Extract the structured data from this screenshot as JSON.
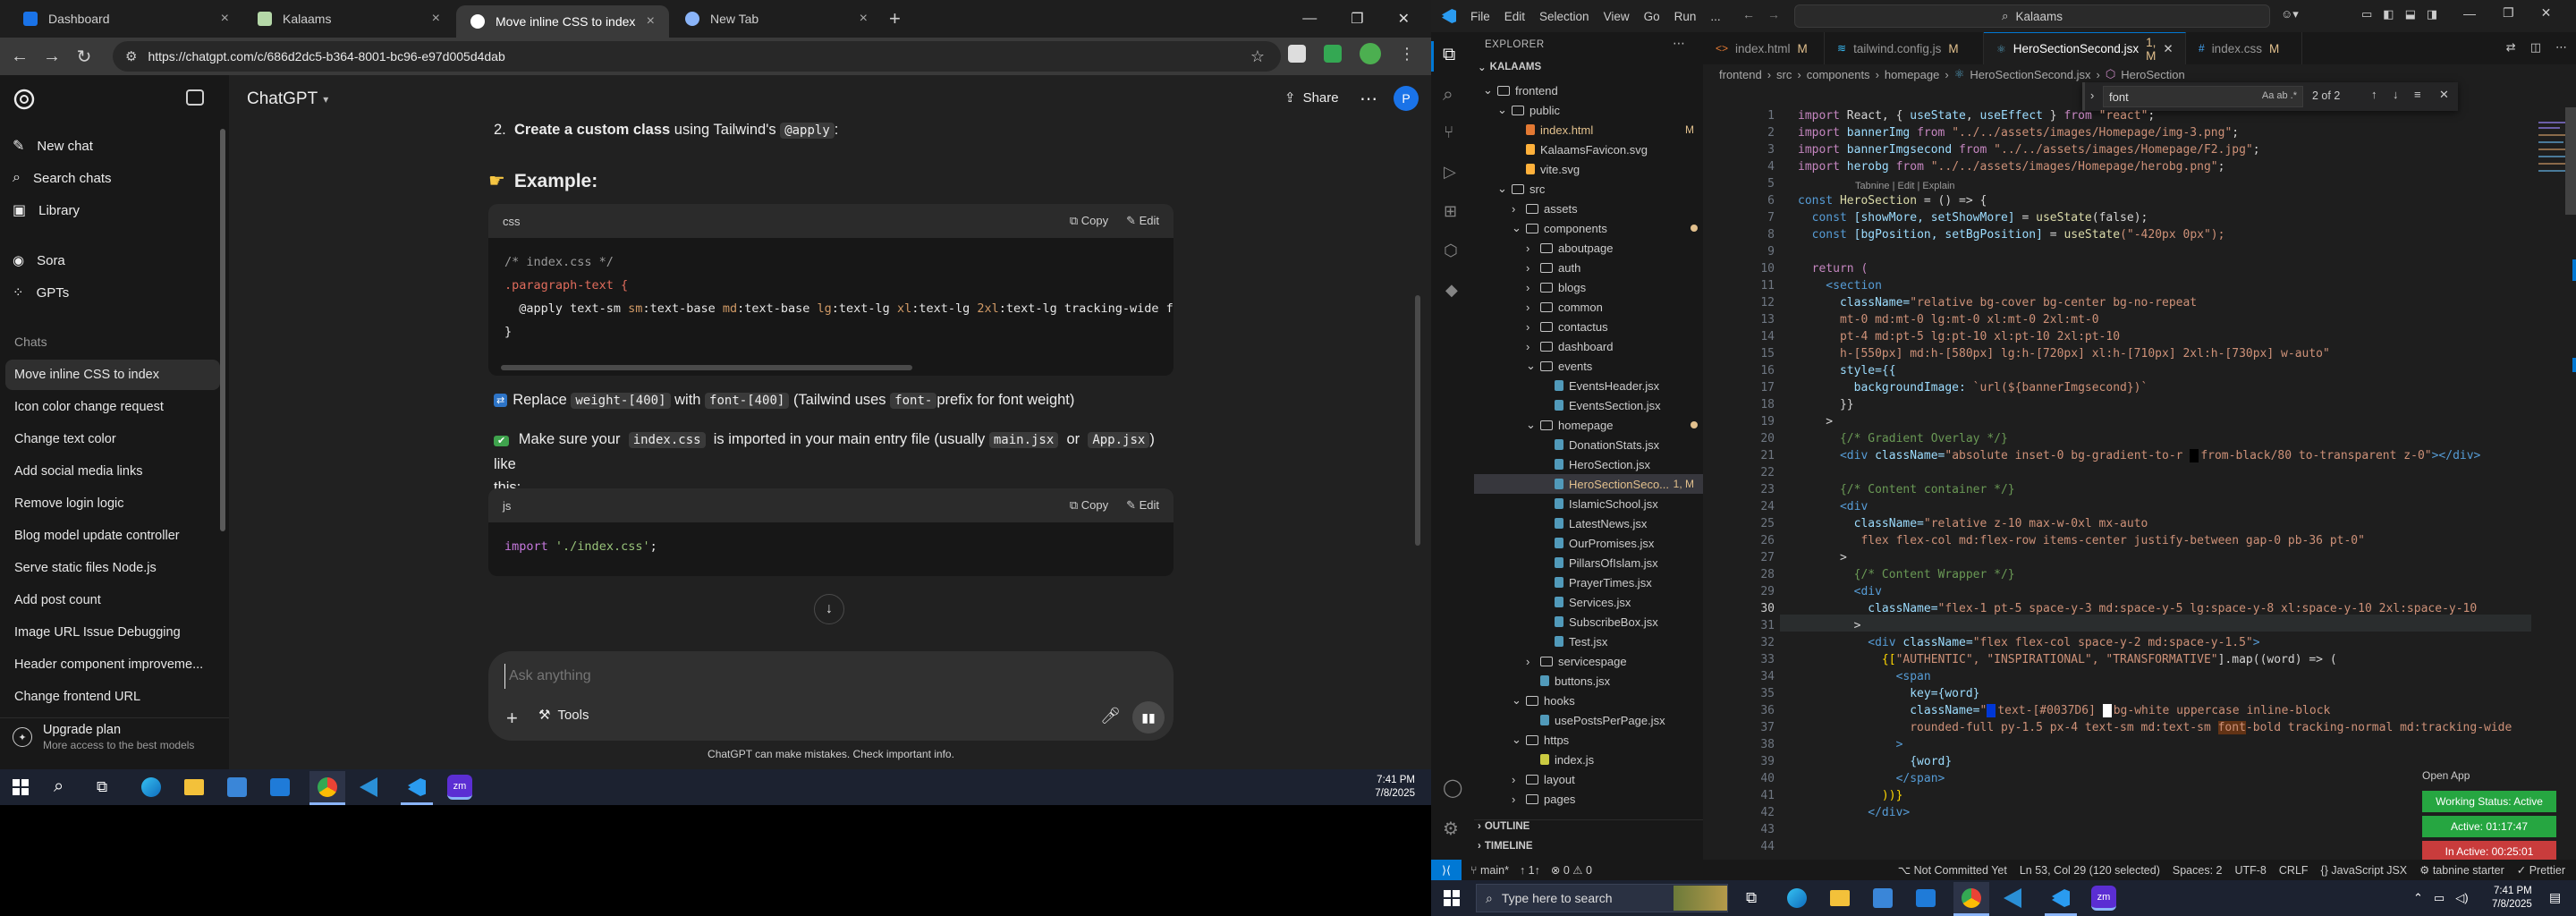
{
  "browser": {
    "tabs": [
      {
        "label": "Dashboard",
        "active": false
      },
      {
        "label": "Kalaams",
        "active": false
      },
      {
        "label": "Move inline CSS to index",
        "active": true
      },
      {
        "label": "New Tab",
        "active": false
      }
    ],
    "url": "https://chatgpt.com/c/686d2dc5-b364-8001-bc96-e97d005d4dab"
  },
  "chatgpt": {
    "model": "ChatGPT",
    "share_label": "Share",
    "sidebar": {
      "top_items": [
        "New chat",
        "Search chats",
        "Library"
      ],
      "gpt_items": [
        "Sora",
        "GPTs"
      ],
      "chats_heading": "Chats",
      "chats": [
        "Move inline CSS to index",
        "Icon color change request",
        "Change text color",
        "Add social media links",
        "Remove login logic",
        "Blog model update controller",
        "Serve static files Node.js",
        "Add post count",
        "Image URL Issue Debugging",
        "Header component improveme...",
        "Change frontend URL"
      ],
      "upgrade_title": "Upgrade plan",
      "upgrade_sub": "More access to the best models"
    },
    "message": {
      "step_num": "2.",
      "step_bold": "Create a custom class",
      "step_rest": " using Tailwind's ",
      "step_code": "@apply",
      "step_end": ":",
      "example_heading": "Example:",
      "code1": {
        "lang": "css",
        "copy": "Copy",
        "edit": "Edit",
        "line1": "/* index.css */",
        "line2": ".paragraph-text {",
        "line3_a": "  @apply text-sm ",
        "line3_b": "sm",
        "line3_c": ":text-base ",
        "line3_d": "md",
        "line3_e": ":text-base ",
        "line3_f": "lg",
        "line3_g": ":text-lg ",
        "line3_h": "xl",
        "line3_i": ":text-lg ",
        "line3_j": "2xl",
        "line3_k": ":text-lg tracking-wide font-[",
        "line4": "}"
      },
      "replace_a": " Replace ",
      "replace_code1": "weight-[400]",
      "replace_b": " with ",
      "replace_code2": "font-[400]",
      "replace_c": " (Tailwind uses ",
      "replace_code3": "font-",
      "replace_d": " prefix for font weight)",
      "sure_a": " Make sure your ",
      "sure_code1": "index.css",
      "sure_b": " is imported in your main entry file (usually ",
      "sure_code2": "main.jsx",
      "sure_c": " or ",
      "sure_code3": "App.jsx",
      "sure_d": ") like",
      "sure_e": "this:",
      "code2": {
        "lang": "js",
        "copy": "Copy",
        "edit": "Edit",
        "kw": "import",
        "str": "'./index.css'",
        "end": ";"
      }
    },
    "composer": {
      "placeholder": "Ask anything",
      "tools": "Tools",
      "disclaimer": "ChatGPT can make mistakes. Check important info."
    }
  },
  "taskbar_left": {
    "time": "7:41 PM",
    "date": "7/8/2025"
  },
  "vscode": {
    "menu": [
      "File",
      "Edit",
      "Selection",
      "View",
      "Go",
      "Run",
      "..."
    ],
    "search": "Kalaams",
    "explorer_title": "EXPLORER",
    "root": "KALAAMS",
    "tree": [
      {
        "label": "frontend",
        "depth": 1,
        "folder": true,
        "open": true
      },
      {
        "label": "public",
        "depth": 2,
        "folder": true,
        "open": true
      },
      {
        "label": "index.html",
        "depth": 3,
        "badge": "M",
        "ic": "#e37933"
      },
      {
        "label": "KalaamsFavicon.svg",
        "depth": 3,
        "ic": "#ffb13b"
      },
      {
        "label": "vite.svg",
        "depth": 3,
        "ic": "#ffb13b"
      },
      {
        "label": "src",
        "depth": 2,
        "folder": true,
        "open": true
      },
      {
        "label": "assets",
        "depth": 3,
        "folder": true
      },
      {
        "label": "components",
        "depth": 3,
        "folder": true,
        "open": true,
        "dot": "#e2c08d"
      },
      {
        "label": "aboutpage",
        "depth": 4,
        "folder": true
      },
      {
        "label": "auth",
        "depth": 4,
        "folder": true
      },
      {
        "label": "blogs",
        "depth": 4,
        "folder": true
      },
      {
        "label": "common",
        "depth": 4,
        "folder": true
      },
      {
        "label": "contactus",
        "depth": 4,
        "folder": true
      },
      {
        "label": "dashboard",
        "depth": 4,
        "folder": true
      },
      {
        "label": "events",
        "depth": 4,
        "folder": true,
        "open": true
      },
      {
        "label": "EventsHeader.jsx",
        "depth": 5,
        "ic": "#519aba"
      },
      {
        "label": "EventsSection.jsx",
        "depth": 5,
        "ic": "#519aba"
      },
      {
        "label": "homepage",
        "depth": 4,
        "folder": true,
        "open": true,
        "dot": "#e2c08d"
      },
      {
        "label": "DonationStats.jsx",
        "depth": 5,
        "ic": "#519aba"
      },
      {
        "label": "HeroSection.jsx",
        "depth": 5,
        "ic": "#519aba"
      },
      {
        "label": "HeroSectionSeco...",
        "depth": 5,
        "ic": "#519aba",
        "badge": "1, M",
        "selected": true
      },
      {
        "label": "IslamicSchool.jsx",
        "depth": 5,
        "ic": "#519aba"
      },
      {
        "label": "LatestNews.jsx",
        "depth": 5,
        "ic": "#519aba"
      },
      {
        "label": "OurPromises.jsx",
        "depth": 5,
        "ic": "#519aba"
      },
      {
        "label": "PillarsOfIslam.jsx",
        "depth": 5,
        "ic": "#519aba"
      },
      {
        "label": "PrayerTimes.jsx",
        "depth": 5,
        "ic": "#519aba"
      },
      {
        "label": "Services.jsx",
        "depth": 5,
        "ic": "#519aba"
      },
      {
        "label": "SubscribeBox.jsx",
        "depth": 5,
        "ic": "#519aba"
      },
      {
        "label": "Test.jsx",
        "depth": 5,
        "ic": "#519aba"
      },
      {
        "label": "servicespage",
        "depth": 4,
        "folder": true
      },
      {
        "label": "buttons.jsx",
        "depth": 4,
        "ic": "#519aba"
      },
      {
        "label": "hooks",
        "depth": 3,
        "folder": true,
        "open": true
      },
      {
        "label": "usePostsPerPage.jsx",
        "depth": 4,
        "ic": "#519aba"
      },
      {
        "label": "https",
        "depth": 3,
        "folder": true,
        "open": true
      },
      {
        "label": "index.js",
        "depth": 4,
        "ic": "#cbcb41"
      },
      {
        "label": "layout",
        "depth": 3,
        "folder": true
      },
      {
        "label": "pages",
        "depth": 3,
        "folder": true
      }
    ],
    "outline": "OUTLINE",
    "timeline": "TIMELINE",
    "tabs": [
      {
        "label": "index.html",
        "badge": "M",
        "active": false
      },
      {
        "label": "tailwind.config.js",
        "badge": "M",
        "active": false
      },
      {
        "label": "HeroSectionSecond.jsx",
        "badge": "1, M",
        "active": true
      },
      {
        "label": "index.css",
        "badge": "M",
        "active": false
      }
    ],
    "breadcrumb": [
      "frontend",
      "src",
      "components",
      "homepage",
      "HeroSectionSecond.jsx",
      "HeroSection"
    ],
    "find": {
      "query": "font",
      "result": "2 of 2"
    },
    "codelens": "Tabnine | Edit | Explain",
    "line_numbers": [
      1,
      2,
      3,
      4,
      5,
      6,
      7,
      8,
      9,
      10,
      11,
      12,
      13,
      14,
      15,
      16,
      17,
      18,
      19,
      20,
      21,
      22,
      23,
      24,
      25,
      26,
      27,
      28,
      29,
      30,
      31,
      32,
      33,
      34,
      35,
      36,
      37,
      38,
      39,
      40,
      41,
      42,
      43,
      44
    ],
    "code": {
      "l1a": "import",
      "l1b": " React, { ",
      "l1c": "useState",
      "l1d": ", ",
      "l1e": "useEffect",
      "l1f": " } ",
      "l1g": "from",
      "l1h": " \"react\"",
      ";": ";",
      "l2b": " bannerImg ",
      "l2h": " \"../../assets/images/Homepage/img-3.png\"",
      "l3b": " bannerImgsecond ",
      "l3h": " \"../../assets/images/Homepage/F2.jpg\"",
      "l4b": " herobg ",
      "l4h": " \"../../assets/images/Homepage/herobg.png\"",
      "l6a": "const",
      "l6b": " HeroSection ",
      "l6c": "= () => {",
      "l7b": "  const ",
      "l7c": "[showMore, setShowMore]",
      "l7d": " = ",
      "l7e": "useState",
      "l7f": "(false);",
      "l8c": "[bgPosition, setBgPosition]",
      "l8f": "(\"-420px 0px\");",
      "l10": "  return (",
      "l11": "    <section",
      "l12a": "      className=",
      "l12b": "\"relative bg-cover bg-center bg-no-repeat",
      "l13": "      mt-0 md:mt-0 lg:mt-0 xl:mt-0 2xl:mt-0",
      "l14": "      pt-4 md:pt-5 lg:pt-10 xl:pt-10 2xl:pt-10",
      "l15": "      h-[550px] md:h-[580px] lg:h-[720px] xl:h-[710px] 2xl:h-[730px] w-auto\"",
      "l16": "      style={{",
      "l17a": "        backgroundImage:",
      "l17b": " `url(${bannerImgsecond})`",
      "l18": "      }}",
      "l19": "    >",
      "l20": "      {/* Gradient Overlay */}",
      "l21a": "      <div ",
      "l21b": "className=",
      "l21c": "\"absolute inset-0 bg-gradient-to-r ",
      "l21d": "from-black/80 to-transparent z-0\"",
      "l21e": "></div>",
      "l23": "      {/* Content container */}",
      "l24": "      <div",
      "l25a": "        className=",
      "l25b": "\"relative z-10 max-w-0xl mx-auto",
      "l26": "         flex flex-col md:flex-row items-center justify-between gap-0 pb-36 pt-0\"",
      "l27": "      >",
      "l28": "        {/* Content Wrapper */}",
      "l29": "        <div",
      "l30a": "          className=",
      "l30b": "\"flex-1 pt-5 space-y-3 md:space-y-5 lg:space-y-8 xl:space-y-10 2xl:space-y-10",
      "l31": "        >",
      "l32a": "          <div ",
      "l32b": "className=",
      "l32c": "\"flex flex-col space-y-2 md:space-y-1.5\"",
      ">": ">",
      "l33a": "            {[",
      "l33b": "\"AUTHENTIC\", \"INSPIRATIONAL\", \"TRANSFORMATIVE\"",
      "l33c": "].map((word) => (",
      "l34": "              <span",
      "l35": "                key={word}",
      "l36a": "                className=",
      "l36b": "\"",
      "l36c": "text-[#0037D6] ",
      "l36d": "bg-white uppercase inline-block",
      "l37a": "                rounded-full py-1.5 px-4 text-sm md:text-sm ",
      "l37b": "font",
      "l37c": "-bold tracking-normal md:tracking-wide",
      "l38": "              >",
      "l39": "                {word}",
      "l40": "              </span>",
      "l41": "            ))}",
      "l42": "          </div>"
    },
    "status": {
      "branch": "main*",
      "sync": "↑ 1↑",
      "errors": "⊗ 0 ⚠ 0",
      "commit": "Not Committed Yet",
      "cursor": "Ln 53, Col 29 (120 selected)",
      "spaces": "Spaces: 2",
      "enc": "UTF-8",
      "eol": "CRLF",
      "lang": "JavaScript JSX",
      "tabnine": "tabnine starter",
      "prettier": "Prettier"
    },
    "open_app": "Open App",
    "work_status": {
      "label": "Working Status: Active",
      "active": "Active: 01:17:47",
      "inactive": "In Active: 00:25:01"
    }
  },
  "taskbar_right": {
    "search": "Type here to search",
    "time": "7:41 PM",
    "date": "7/8/2025"
  },
  "colors": {
    "accent": "#0078d4",
    "green": "#26a641",
    "red": "#c93c3c"
  }
}
